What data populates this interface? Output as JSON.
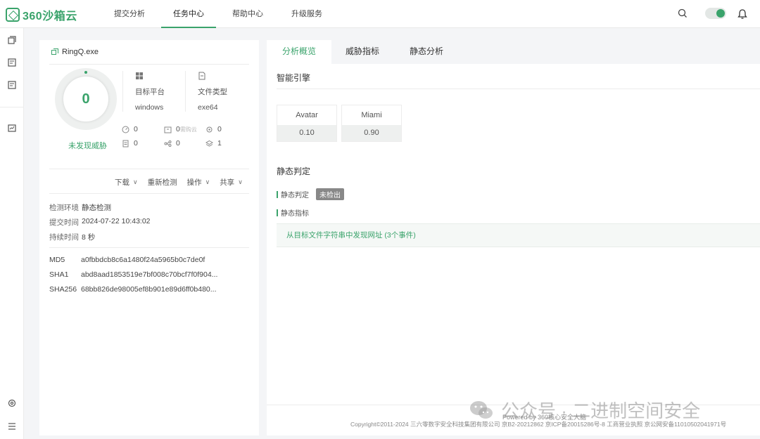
{
  "header": {
    "logo_text": "360沙箱云",
    "nav": [
      {
        "label": "提交分析",
        "active": false
      },
      {
        "label": "任务中心",
        "active": true
      },
      {
        "label": "帮助中心",
        "active": false
      },
      {
        "label": "升级服务",
        "active": false
      }
    ],
    "icons": [
      "search-icon",
      "theme-toggle",
      "bell-icon"
    ]
  },
  "rail": {
    "icons": [
      "copy-icon",
      "report-icon",
      "report-icon",
      "chart-icon",
      "settings-icon",
      "menu-icon"
    ]
  },
  "file": {
    "name": "RingQ.exe",
    "score": "0",
    "verdict": "未发现威胁",
    "platform_label": "目标平台",
    "platform_value": "windows",
    "type_label": "文件类型",
    "type_value": "exe64",
    "stats": {
      "s1": "0",
      "s2": "0",
      "s3": "0",
      "s4": "0",
      "s5": "0",
      "s6": "1",
      "s2_hint": "需购云"
    },
    "actions": [
      {
        "label": "下载",
        "dropdown": true
      },
      {
        "label": "重新检测",
        "dropdown": false
      },
      {
        "label": "操作",
        "dropdown": true
      },
      {
        "label": "共享",
        "dropdown": true
      }
    ],
    "env_label": "检测环境",
    "env_value": "静态检测",
    "submit_label": "提交时间",
    "submit_value": "2024-07-22 10:43:02",
    "duration_label": "持续时间",
    "duration_value": "8 秒",
    "md5_label": "MD5",
    "md5_value": "a0fbbdcb8c6a1480f24a5965b0c7de0f",
    "sha1_label": "SHA1",
    "sha1_value": "abd8aad1853519e7bf008c70bcf7f0f904...",
    "sha256_label": "SHA256",
    "sha256_value": "68bb826de98005ef8b901e89d6ff0b480..."
  },
  "right": {
    "tabs": [
      {
        "label": "分析概览",
        "active": true
      },
      {
        "label": "威胁指标",
        "active": false
      },
      {
        "label": "静态分析",
        "active": false
      }
    ],
    "engine_title": "智能引擎",
    "engines": [
      {
        "name": "Avatar",
        "value": "0.10"
      },
      {
        "name": "Miami",
        "value": "0.90"
      }
    ],
    "static_title": "静态判定",
    "static_verdict_label": "静态判定",
    "static_verdict_badge": "未检出",
    "static_indicator_label": "静态指标",
    "finding": "从目标文件字符串中发现网址 (3个事件)"
  },
  "footer": {
    "powered": "Powered by 360核心安全大脑",
    "copyright": "Copyright©2011-2024 三六零数字安全科技集团有限公司 京B2-20212862   京ICP备20015286号-8   工商营业执照   京公网安备11010502041971号"
  },
  "watermark": "公众号 · 二进制空间安全",
  "colors": {
    "accent": "#3aa36b",
    "badge": "#888888"
  }
}
